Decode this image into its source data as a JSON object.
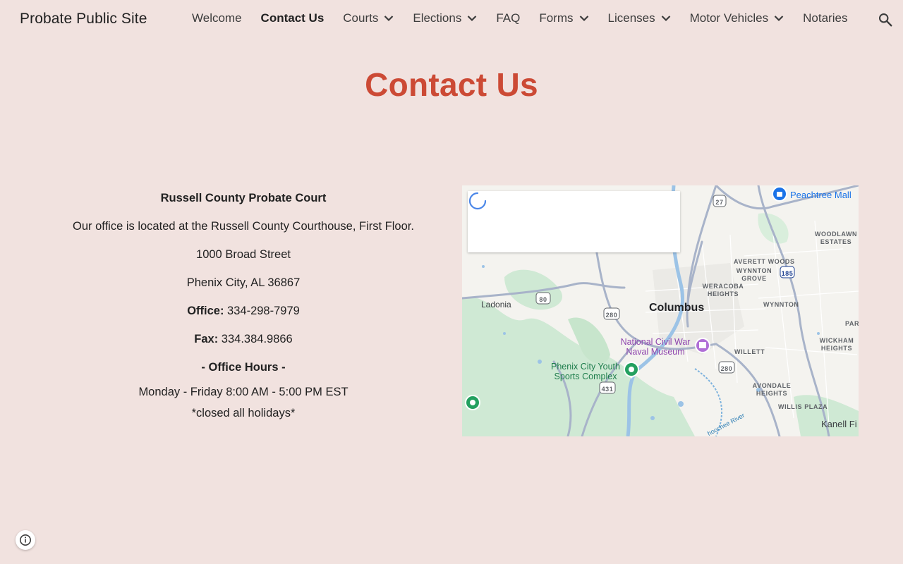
{
  "header": {
    "site_title": "Probate Public Site",
    "nav": [
      {
        "label": "Welcome",
        "dropdown": false,
        "active": false
      },
      {
        "label": "Contact Us",
        "dropdown": false,
        "active": true
      },
      {
        "label": "Courts",
        "dropdown": true,
        "active": false
      },
      {
        "label": "Elections",
        "dropdown": true,
        "active": false
      },
      {
        "label": "FAQ",
        "dropdown": false,
        "active": false
      },
      {
        "label": "Forms",
        "dropdown": true,
        "active": false
      },
      {
        "label": "Licenses",
        "dropdown": true,
        "active": false
      },
      {
        "label": "Motor Vehicles",
        "dropdown": true,
        "active": false
      },
      {
        "label": "Notaries",
        "dropdown": false,
        "active": false
      }
    ],
    "search_icon": "search-icon"
  },
  "page": {
    "title": "Contact Us"
  },
  "contact": {
    "court_name": "Russell County Probate Court",
    "location": "Our office is located at the Russell County Courthouse, First Floor.",
    "street": "1000 Broad Street",
    "city": "Phenix City, AL 36867",
    "office_label": "Office:",
    "office_phone": "334-298-7979",
    "fax_label": "Fax:",
    "fax_number": "334.384.9866",
    "hours_heading": "- Office Hours -",
    "hours": "Monday - Friday 8:00 AM - 5:00 PM EST",
    "holidays": "*closed all holidays*"
  },
  "map": {
    "labels": {
      "columbus": "Columbus",
      "ladonia": "Ladonia",
      "peachtree": "Peachtree Mall",
      "woodlawn": "WOODLAWN ESTATES",
      "averett": "AVERETT WOODS",
      "wynnton_grove": "WYNNTON GROVE",
      "weracoba": "WERACOBA HEIGHTS",
      "wynnton": "WYNNTON",
      "par": "PAR",
      "museum": "National Civil War Naval Museum",
      "wickham": "WICKHAM HEIGHTS",
      "willett": "WILLETT",
      "youth": "Phenix City Youth Sports Complex",
      "avondale": "AVONDALE HEIGHTS",
      "willis": "WILLIS PLAZA",
      "kanell": "Kanell Fi",
      "river": "hoochee River",
      "shield_27": "27",
      "shield_185": "185",
      "shield_80": "80",
      "shield_280a": "280",
      "shield_280b": "280",
      "shield_431": "431"
    }
  },
  "colors": {
    "background": "#f1e2df",
    "title_accent": "#cc4a35",
    "text": "#212121"
  }
}
